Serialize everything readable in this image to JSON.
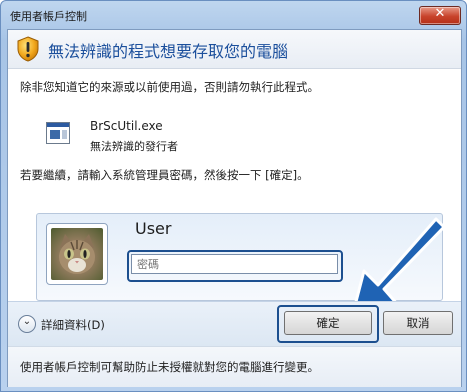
{
  "window": {
    "title": "使用者帳戶控制",
    "close_glyph": "✕"
  },
  "header": {
    "icon": "uac-shield-warning-icon",
    "title": "無法辨識的程式想要存取您的電腦"
  },
  "body": {
    "warning_text": "除非您知道它的來源或以前使用過，否則請勿執行此程式。",
    "program": {
      "icon": "program-window-icon",
      "name": "BrScUtil.exe",
      "publisher": "無法辨識的發行者"
    },
    "instruction": "若要繼續，請輸入系統管理員密碼，然後按一下 [確定]。"
  },
  "credentials": {
    "avatar": "user-avatar-kitten",
    "user_name": "User",
    "password_placeholder": "密碼"
  },
  "annotation": {
    "icon": "blue-pointer-arrow"
  },
  "actions": {
    "details_label": "詳細資料(D)",
    "ok_label": "確定",
    "cancel_label": "取消"
  },
  "footer": {
    "text": "使用者帳戶控制可幫助防止未授權就對您的電腦進行變更。"
  },
  "colors": {
    "title_blue": "#1b4f9c",
    "focus_border": "#1c4f8f",
    "arrow_blue": "#1f63b4",
    "close_red": "#c8432b"
  }
}
